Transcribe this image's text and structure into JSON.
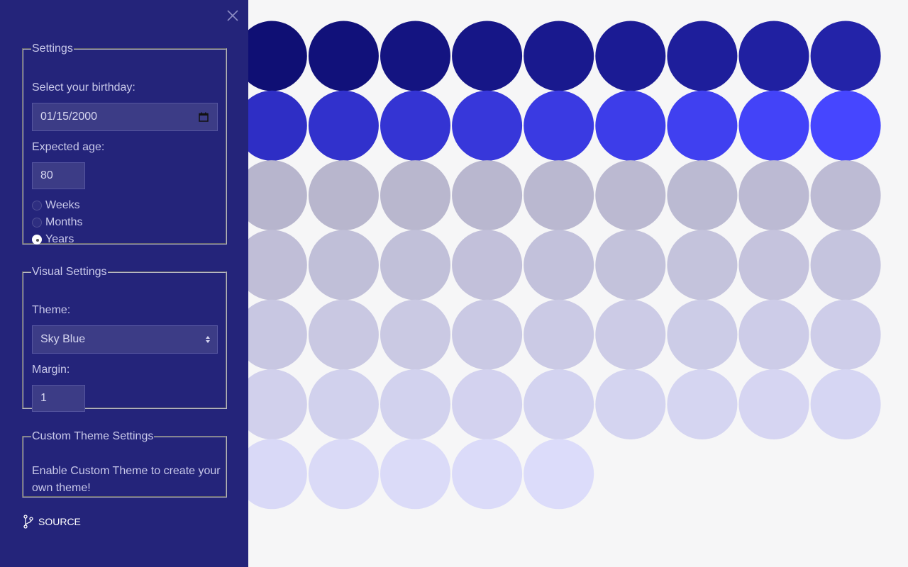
{
  "sidebar": {
    "settings": {
      "legend": "Settings",
      "birthday_label": "Select your birthday:",
      "birthday_value": "01/15/2000",
      "expected_age_label": "Expected age:",
      "expected_age_value": "80",
      "units": [
        {
          "label": "Weeks",
          "checked": false
        },
        {
          "label": "Months",
          "checked": false
        },
        {
          "label": "Years",
          "checked": true
        }
      ]
    },
    "visual": {
      "legend": "Visual Settings",
      "theme_label": "Theme:",
      "theme_value": "Sky Blue",
      "margin_label": "Margin:",
      "margin_value": "1"
    },
    "custom": {
      "legend": "Custom Theme Settings",
      "text": "Enable Custom Theme to create your own theme!"
    },
    "source_label": "SOURCE"
  },
  "grid": {
    "total_units": 80,
    "elapsed_units": 24,
    "current_unit_progress": 0.23,
    "columns": 12,
    "colors": {
      "background": "#f6f6f7",
      "elapsed_start": "#070760",
      "elapsed_mid": "#2424ab",
      "elapsed_end": "#4646ff",
      "remaining_start": "#b5b3ca",
      "remaining_end": "#dcdcfa"
    }
  },
  "colors": {
    "sidebar_bg": "#24247a",
    "input_bg": "#3c3c86"
  }
}
